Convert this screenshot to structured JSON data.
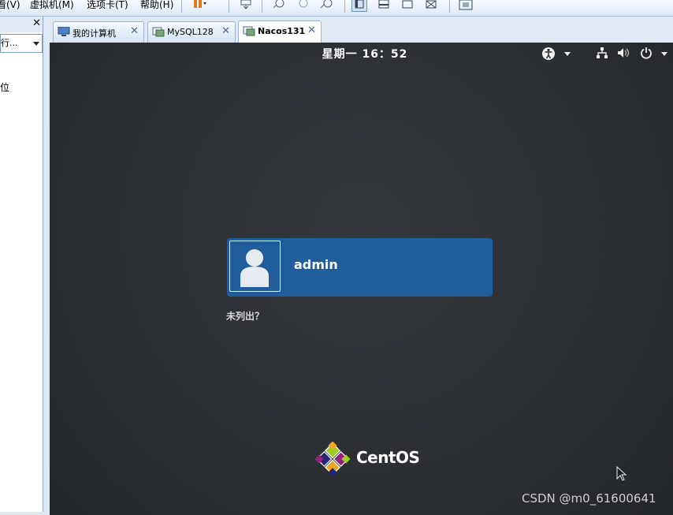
{
  "menubar": {
    "items": [
      "看(V)",
      "虚拟机(M)",
      "选项卡(T)",
      "帮助(H)"
    ]
  },
  "left_panel": {
    "close_label": "✕",
    "select_value": "行...",
    "item_label": "位"
  },
  "tabs": [
    {
      "label": "我的计算机",
      "close": "✕"
    },
    {
      "label": "MySQL128",
      "close": "✕"
    },
    {
      "label": "Nacos131",
      "close": "✕"
    }
  ],
  "vm": {
    "clock": "星期一 16：52",
    "user": {
      "name": "admin"
    },
    "not_listed": "未列出？",
    "logo_text": "CentOS",
    "watermark": "CSDN @m0_61600641"
  },
  "icons": {
    "accessibility": "accessibility-icon",
    "network": "network-icon",
    "volume": "volume-icon",
    "power": "power-icon"
  },
  "colors": {
    "vm_background": "#2b2f32",
    "user_card": "#215d9c",
    "window_chrome": "#dfe8f3"
  }
}
